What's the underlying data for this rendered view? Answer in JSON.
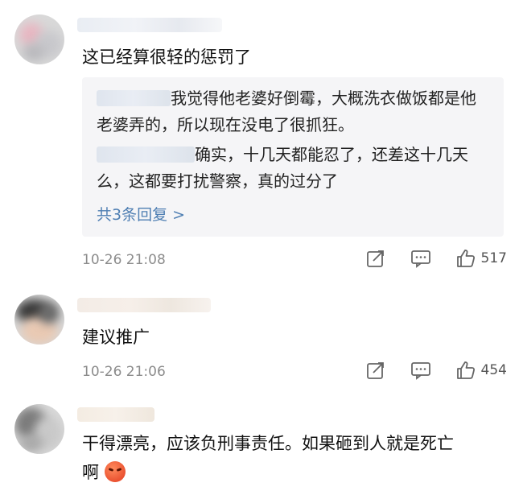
{
  "comments": [
    {
      "text": "这已经算很轻的惩罚了",
      "replies": [
        {
          "text": "我觉得他老婆好倒霉，大概洗衣做饭都是他老婆弄的，所以现在没电了很抓狂。"
        },
        {
          "text": "确实，十几天都能忍了，还差这十几天么，这都要打扰警察，真的过分了"
        }
      ],
      "more_replies": "共3条回复 >",
      "time": "10-26 21:08",
      "likes": "517"
    },
    {
      "text": "建议推广",
      "time": "10-26 21:06",
      "likes": "454"
    },
    {
      "text_line1": "干得漂亮，应该负刑事责任。如果砸到人就是死亡",
      "text_line2": "啊",
      "emoji": "angry-emoji"
    }
  ],
  "icons": {
    "share": "share-icon",
    "reply": "comment-icon",
    "like": "thumbs-up-icon"
  },
  "colors": {
    "link": "#4f7fb3",
    "meta": "#8c8c8c",
    "reply_bg": "#f5f5f7"
  }
}
